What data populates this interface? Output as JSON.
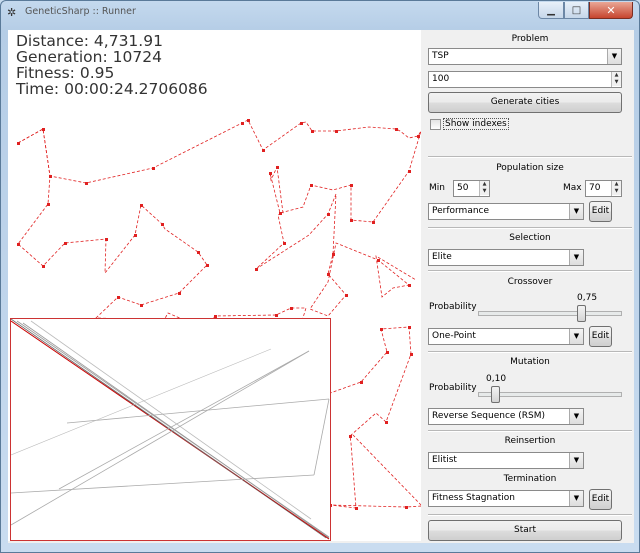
{
  "window": {
    "title": "GeneticSharp :: Runner",
    "minimize": "▁",
    "maximize": "□",
    "close": "✕"
  },
  "stats": {
    "distance": "Distance: 4,731.91",
    "generation": "Generation: 10724",
    "fitness": "Fitness: 0.95",
    "time": "Time: 00:00:24.2706086"
  },
  "problem": {
    "title": "Problem",
    "selected": "TSP",
    "cities_count": "100",
    "generate_label": "Generate cities",
    "show_indexes_label": "Show indexes",
    "show_indexes_checked": false
  },
  "population": {
    "title": "Population size",
    "min_label": "Min",
    "min_value": "50",
    "max_label": "Max",
    "max_value": "70",
    "generation_strategy": "Performance",
    "edit_label": "Edit"
  },
  "selection": {
    "title": "Selection",
    "selected": "Elite"
  },
  "crossover": {
    "title": "Crossover",
    "probability_label": "Probability",
    "probability_value": "0,75",
    "probability": 0.75,
    "selected": "One-Point",
    "edit_label": "Edit"
  },
  "mutation": {
    "title": "Mutation",
    "probability_label": "Probability",
    "probability_value": "0,10",
    "probability": 0.1,
    "selected": "Reverse Sequence (RSM)"
  },
  "reinsertion": {
    "title": "Reinsertion",
    "selected": "Elitist"
  },
  "termination": {
    "title": "Termination",
    "selected": "Fitness Stagnation",
    "edit_label": "Edit"
  },
  "start_label": "Start",
  "colors": {
    "route": "#e02020",
    "chart_border": "#cc3333",
    "chart_lines": "#999999",
    "best_line": "#cc0000"
  }
}
